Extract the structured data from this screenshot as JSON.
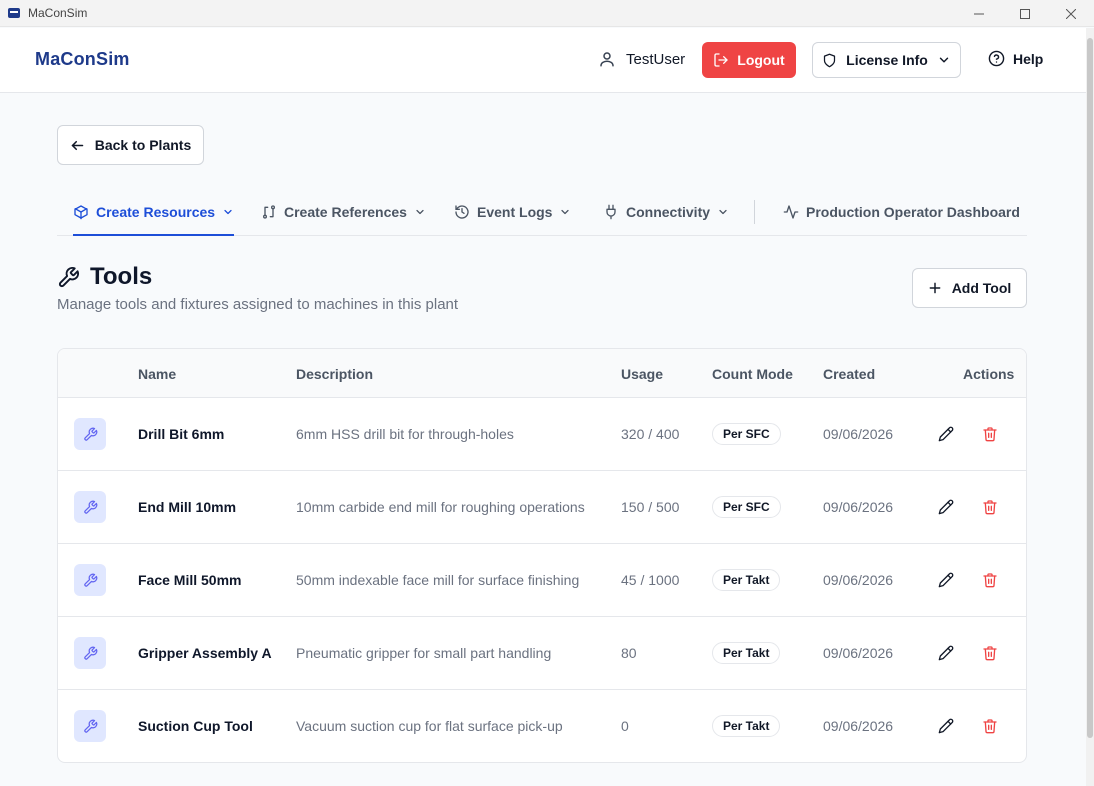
{
  "window": {
    "title": "MaConSim"
  },
  "header": {
    "logo": "MaConSim",
    "user": "TestUser",
    "logout_label": "Logout",
    "license_label": "License Info",
    "help_label": "Help"
  },
  "nav": {
    "back_label": "Back to Plants",
    "tabs": [
      {
        "label": "Create Resources"
      },
      {
        "label": "Create References"
      },
      {
        "label": "Event Logs"
      },
      {
        "label": "Connectivity"
      },
      {
        "label": "Production Operator Dashboard"
      }
    ]
  },
  "section": {
    "title": "Tools",
    "subtitle": "Manage tools and fixtures assigned to machines in this plant",
    "add_label": "Add Tool"
  },
  "table": {
    "columns": [
      "Name",
      "Description",
      "Usage",
      "Count Mode",
      "Created",
      "Actions"
    ],
    "rows": [
      {
        "name": "Drill Bit 6mm",
        "description": "6mm HSS drill bit for through-holes",
        "usage": "320 / 400",
        "count_mode": "Per SFC",
        "created": "09/06/2026"
      },
      {
        "name": "End Mill 10mm",
        "description": "10mm carbide end mill for roughing operations",
        "usage": "150 / 500",
        "count_mode": "Per SFC",
        "created": "09/06/2026"
      },
      {
        "name": "Face Mill 50mm",
        "description": "50mm indexable face mill for surface finishing",
        "usage": "45 / 1000",
        "count_mode": "Per Takt",
        "created": "09/06/2026"
      },
      {
        "name": "Gripper Assembly A",
        "description": "Pneumatic gripper for small part handling",
        "usage": "80",
        "count_mode": "Per Takt",
        "created": "09/06/2026"
      },
      {
        "name": "Suction Cup Tool",
        "description": "Vacuum suction cup for flat surface pick-up",
        "usage": "0",
        "count_mode": "Per Takt",
        "created": "09/06/2026"
      }
    ]
  },
  "colors": {
    "accent": "#1d4ed8",
    "danger": "#ef4444",
    "logo": "#1e3a8a",
    "icon_bg": "#e0e7ff"
  }
}
